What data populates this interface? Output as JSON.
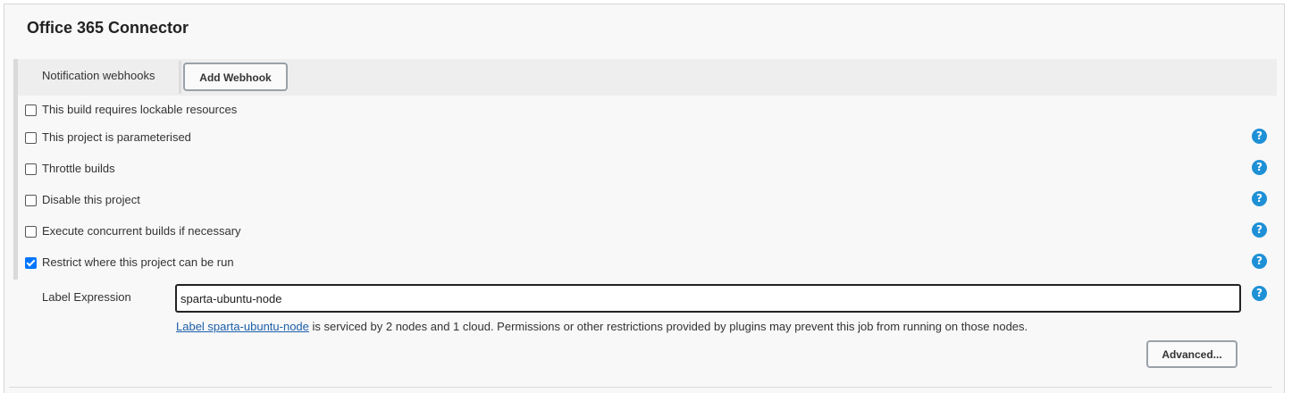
{
  "section": {
    "title": "Office 365 Connector"
  },
  "notifications": {
    "label": "Notification webhooks",
    "add_button": "Add Webhook"
  },
  "options": [
    {
      "label": "This build requires lockable resources",
      "checked": false,
      "help": false
    },
    {
      "label": "This project is parameterised",
      "checked": false,
      "help": true
    },
    {
      "label": "Throttle builds",
      "checked": false,
      "help": true
    },
    {
      "label": "Disable this project",
      "checked": false,
      "help": true
    },
    {
      "label": "Execute concurrent builds if necessary",
      "checked": false,
      "help": true
    },
    {
      "label": "Restrict where this project can be run",
      "checked": true,
      "help": true
    }
  ],
  "label_expression": {
    "label": "Label Expression",
    "value": "sparta-ubuntu-node",
    "link_text": "Label sparta-ubuntu-node",
    "info_text": " is serviced by 2 nodes and 1 cloud. Permissions or other restrictions provided by plugins may prevent this job from running on those nodes."
  },
  "advanced_button": "Advanced...",
  "help_glyph": "?",
  "icons": {
    "help": "question-circle-icon"
  },
  "colors": {
    "help": "#1e90d6",
    "link": "#1d5fa8",
    "checkbox_checked": "#0075ff"
  }
}
